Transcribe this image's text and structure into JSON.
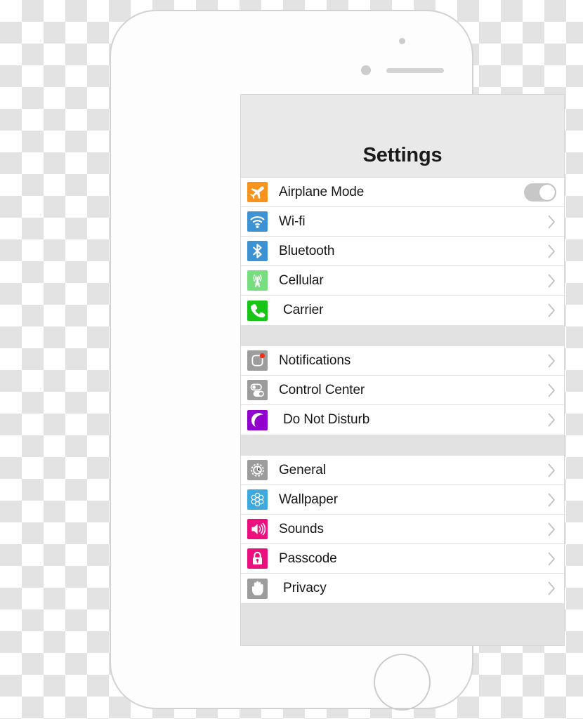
{
  "device": {
    "name": "iphone-mockup",
    "sensor": "proximity-sensor",
    "camera": "front-camera",
    "earpiece": "earpiece-speaker",
    "home_button": "home-button"
  },
  "navbar": {
    "title": "Settings"
  },
  "colors": {
    "airplane": "#f79420",
    "wifi": "#3d92d4",
    "bluetooth": "#3d92d4",
    "cellular": "#76de7f",
    "carrier": "#18c418",
    "notifications": "#9c9c9c",
    "control_center": "#9c9c9c",
    "do_not_disturb": "#9100cc",
    "general": "#9c9c9c",
    "wallpaper": "#3fa8dc",
    "sounds": "#ec0f7e",
    "passcode": "#ec0f7e",
    "privacy": "#9c9c9c",
    "badge_red": "#f2301a",
    "screen_bg": "#e2e2e2",
    "row_bg": "#ffffff",
    "navbar_bg": "#e9e9e9",
    "chevron": "#c2c2c2",
    "toggle_off_track": "#c7c7c7",
    "toggle_knob": "#ffffff"
  },
  "groups": [
    {
      "name": "connectivity-group",
      "rows": [
        {
          "label": "Airplane Mode",
          "icon": "airplane-icon",
          "accessory": "toggle",
          "toggle_on": false,
          "indented": false
        },
        {
          "label": "Wi-fi",
          "icon": "wifi-icon",
          "accessory": "chevron",
          "indented": false
        },
        {
          "label": "Bluetooth",
          "icon": "bluetooth-icon",
          "accessory": "chevron",
          "indented": false
        },
        {
          "label": "Cellular",
          "icon": "cellular-icon",
          "accessory": "chevron",
          "indented": false
        },
        {
          "label": "Carrier",
          "icon": "carrier-phone-icon",
          "accessory": "chevron",
          "indented": true
        }
      ]
    },
    {
      "name": "notifications-group",
      "rows": [
        {
          "label": "Notifications",
          "icon": "notifications-icon",
          "accessory": "chevron",
          "indented": false
        },
        {
          "label": "Control Center",
          "icon": "control-center-icon",
          "accessory": "chevron",
          "indented": false
        },
        {
          "label": "Do Not Disturb",
          "icon": "do-not-disturb-moon-icon",
          "accessory": "chevron",
          "indented": true
        }
      ]
    },
    {
      "name": "system-group",
      "rows": [
        {
          "label": "General",
          "icon": "gear-icon",
          "accessory": "chevron",
          "indented": false
        },
        {
          "label": "Wallpaper",
          "icon": "wallpaper-flower-icon",
          "accessory": "chevron",
          "indented": false
        },
        {
          "label": "Sounds",
          "icon": "speaker-icon",
          "accessory": "chevron",
          "indented": false
        },
        {
          "label": "Passcode",
          "icon": "lock-icon",
          "accessory": "chevron",
          "indented": false
        },
        {
          "label": "Privacy",
          "icon": "hand-icon",
          "accessory": "chevron",
          "indented": true
        }
      ]
    }
  ]
}
